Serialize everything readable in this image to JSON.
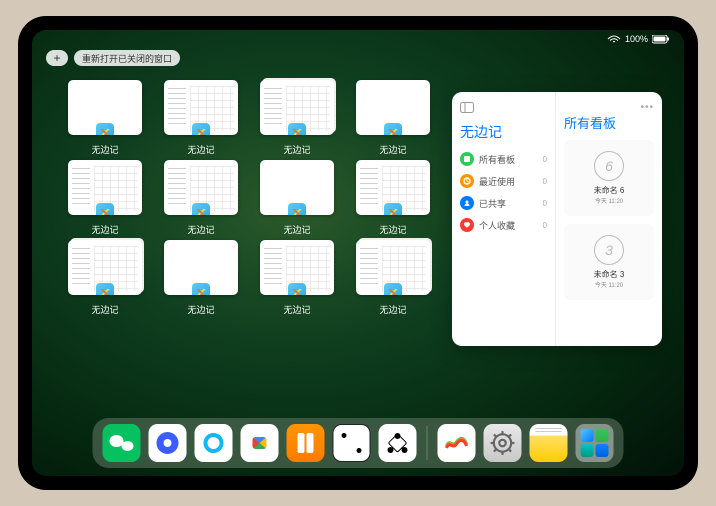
{
  "status": {
    "battery_pct": "100%"
  },
  "topbar": {
    "plus_label": "+",
    "reopen_label": "重新打开已关闭的窗口"
  },
  "window_label": "无边记",
  "windows": [
    {
      "variant": "blank"
    },
    {
      "variant": "calendar"
    },
    {
      "variant": "calendar-stack"
    },
    {
      "variant": "blank"
    },
    {
      "variant": "calendar"
    },
    {
      "variant": "calendar"
    },
    {
      "variant": "blank"
    },
    {
      "variant": "calendar"
    },
    {
      "variant": "calendar-stack"
    },
    {
      "variant": "blank"
    },
    {
      "variant": "calendar"
    },
    {
      "variant": "calendar-stack"
    }
  ],
  "sidecard": {
    "left_title": "无边记",
    "items": [
      {
        "label": "所有看板",
        "count": "0"
      },
      {
        "label": "最近使用",
        "count": "0"
      },
      {
        "label": "已共享",
        "count": "0"
      },
      {
        "label": "个人收藏",
        "count": "0"
      }
    ],
    "right_title": "所有看板",
    "boards": [
      {
        "sketch": "6",
        "name": "未命名 6",
        "date": "今天 11:20"
      },
      {
        "sketch": "3",
        "name": "未命名 3",
        "date": "今天 11:20"
      }
    ]
  },
  "dock": [
    "wechat",
    "qq1",
    "qq2",
    "play",
    "books",
    "dice",
    "nodes",
    "freeform",
    "settings",
    "notes",
    "folder"
  ]
}
